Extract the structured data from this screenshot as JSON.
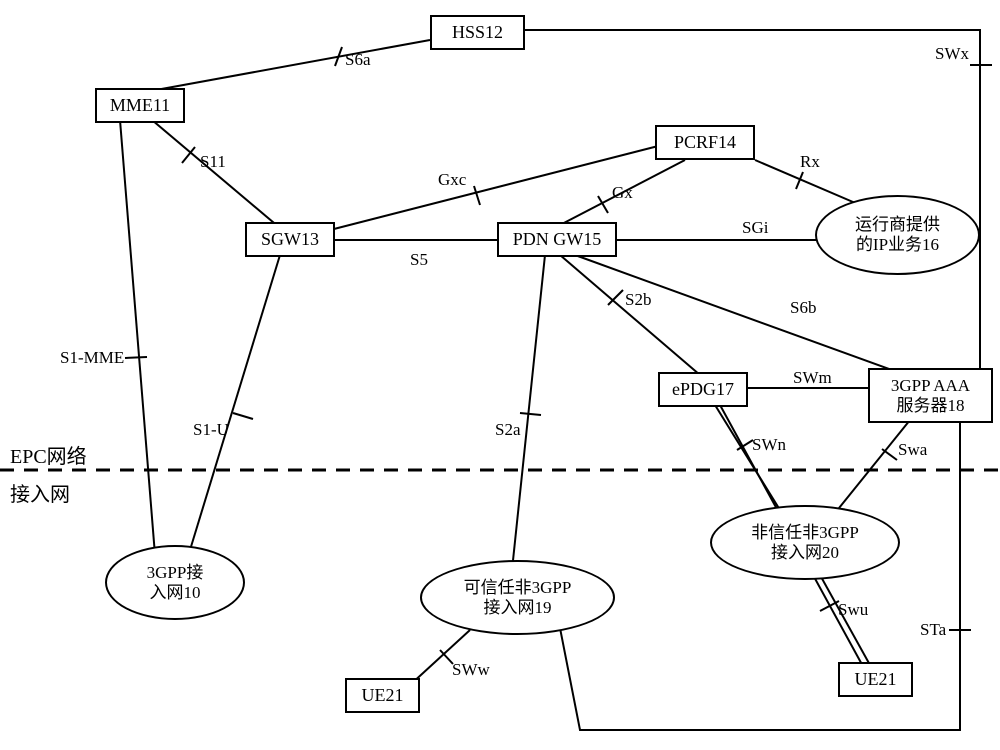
{
  "nodes": {
    "hss": {
      "text": "HSS12"
    },
    "mme": {
      "text": "MME11"
    },
    "sgw": {
      "text": "SGW13"
    },
    "pdngw": {
      "text": "PDN GW15"
    },
    "pcrf": {
      "text": "PCRF14"
    },
    "operator": {
      "text": "运行商提供\n的IP业务16"
    },
    "epdg": {
      "text": "ePDG17"
    },
    "aaa": {
      "text": "3GPP AAA\n服务器18"
    },
    "ran3gpp": {
      "text": "3GPP接\n入网10"
    },
    "trusted": {
      "text": "可信任非3GPP\n接入网19"
    },
    "untrusted": {
      "text": "非信任非3GPP\n接入网20"
    },
    "ue21a": {
      "text": "UE21"
    },
    "ue21b": {
      "text": "UE21"
    }
  },
  "edge_labels": {
    "s6a": "S6a",
    "swx": "SWx",
    "s11": "S11",
    "gxc": "Gxc",
    "gx": "Gx",
    "rx": "Rx",
    "sgi": "SGi",
    "s5": "S5",
    "s2b": "S2b",
    "s6b": "S6b",
    "s2a": "S2a",
    "swm": "SWm",
    "swn": "SWn",
    "swa": "Swa",
    "s1mme": "S1-MME",
    "s1u": "S1-U",
    "sta": "STa",
    "swu": "Swu",
    "sww": "SWw"
  },
  "zones": {
    "epc": "EPC网络",
    "access": "接入网"
  }
}
